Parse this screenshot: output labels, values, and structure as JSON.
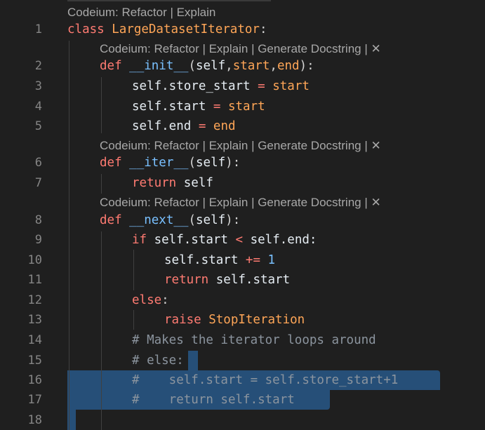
{
  "codelens": {
    "top": "Codeium: Refactor | Explain",
    "method": "Codeium: Refactor | Explain | Generate Docstring | ✕"
  },
  "lines": [
    {
      "n": "1",
      "tokens": [
        [
          "kw",
          "class "
        ],
        [
          "cls",
          "LargeDatasetIterator"
        ],
        [
          "p",
          ":"
        ]
      ]
    },
    {
      "n": "2",
      "tokens": [
        [
          "kw",
          "def "
        ],
        [
          "fn",
          "__init__"
        ],
        [
          "p",
          "("
        ],
        [
          "self",
          "self"
        ],
        [
          "p",
          ","
        ],
        [
          "cls",
          "start"
        ],
        [
          "p",
          ","
        ],
        [
          "cls",
          "end"
        ],
        [
          "p",
          "):"
        ]
      ]
    },
    {
      "n": "3",
      "tokens": [
        [
          "self",
          "self.store_start "
        ],
        [
          "op",
          "="
        ],
        [
          "cls",
          " start"
        ]
      ]
    },
    {
      "n": "4",
      "tokens": [
        [
          "self",
          "self.start "
        ],
        [
          "op",
          "="
        ],
        [
          "cls",
          " start"
        ]
      ]
    },
    {
      "n": "5",
      "tokens": [
        [
          "self",
          "self.end "
        ],
        [
          "op",
          "="
        ],
        [
          "cls",
          " end"
        ]
      ]
    },
    {
      "n": "6",
      "tokens": [
        [
          "kw",
          "def "
        ],
        [
          "fn",
          "__iter__"
        ],
        [
          "p",
          "("
        ],
        [
          "self",
          "self"
        ],
        [
          "p",
          "):"
        ]
      ]
    },
    {
      "n": "7",
      "tokens": [
        [
          "kw",
          "return "
        ],
        [
          "self",
          "self"
        ]
      ]
    },
    {
      "n": "8",
      "tokens": [
        [
          "kw",
          "def "
        ],
        [
          "fn",
          "__next__"
        ],
        [
          "p",
          "("
        ],
        [
          "self",
          "self"
        ],
        [
          "p",
          "):"
        ]
      ]
    },
    {
      "n": "9",
      "tokens": [
        [
          "kw",
          "if "
        ],
        [
          "self",
          "self.start "
        ],
        [
          "op",
          "<"
        ],
        [
          "self",
          " self.end:"
        ]
      ]
    },
    {
      "n": "10",
      "tokens": [
        [
          "self",
          "self.start "
        ],
        [
          "op",
          "+="
        ],
        [
          "num",
          " 1"
        ]
      ]
    },
    {
      "n": "11",
      "tokens": [
        [
          "kw",
          "return "
        ],
        [
          "self",
          "self.start"
        ]
      ]
    },
    {
      "n": "12",
      "tokens": [
        [
          "kw",
          "else"
        ],
        [
          "p",
          ":"
        ]
      ]
    },
    {
      "n": "13",
      "tokens": [
        [
          "kw",
          "raise "
        ],
        [
          "cls",
          "StopIteration"
        ]
      ]
    },
    {
      "n": "14",
      "tokens": [
        [
          "cmt",
          "# Makes the iterator loops around"
        ]
      ]
    },
    {
      "n": "15",
      "tokens": [
        [
          "cmt",
          "# else:"
        ]
      ]
    },
    {
      "n": "16",
      "tokens": [
        [
          "cmt",
          "#    self.start = self.store_start+1"
        ]
      ]
    },
    {
      "n": "17",
      "tokens": [
        [
          "cmt",
          "#    return self.start"
        ]
      ]
    },
    {
      "n": "18",
      "tokens": []
    }
  ]
}
